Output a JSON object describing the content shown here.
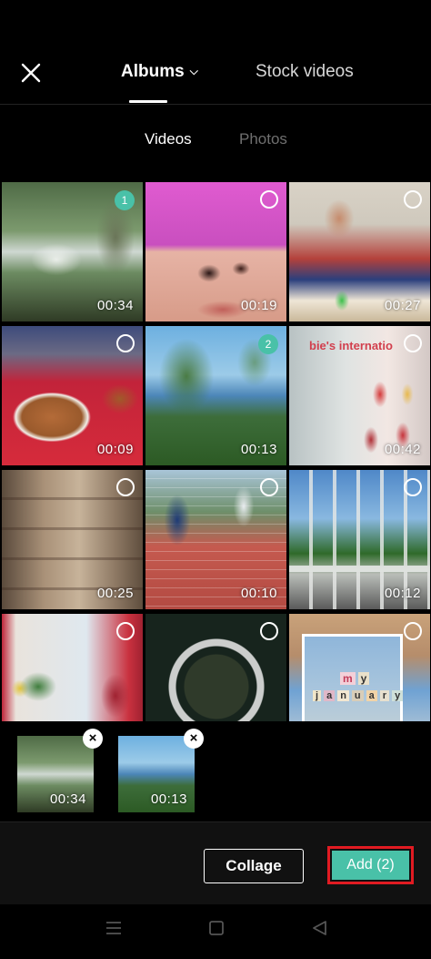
{
  "header": {
    "tabs": [
      {
        "label": "Albums",
        "active": true
      },
      {
        "label": "Stock videos",
        "active": false
      }
    ],
    "icons": {
      "close": "close-icon",
      "albums_dropdown": "chevron-down-icon"
    }
  },
  "media_tabs": [
    {
      "label": "Videos",
      "active": true
    },
    {
      "label": "Photos",
      "active": false
    }
  ],
  "grid": {
    "items": [
      {
        "duration": "00:34",
        "selected_order": "1"
      },
      {
        "duration": "00:19",
        "selected_order": ""
      },
      {
        "duration": "00:27",
        "selected_order": ""
      },
      {
        "duration": "00:09",
        "selected_order": ""
      },
      {
        "duration": "00:13",
        "selected_order": "2"
      },
      {
        "duration": "00:42",
        "selected_order": ""
      },
      {
        "duration": "00:25",
        "selected_order": ""
      },
      {
        "duration": "00:10",
        "selected_order": ""
      },
      {
        "duration": "00:12",
        "selected_order": ""
      },
      {
        "duration": "",
        "selected_order": ""
      },
      {
        "duration": "",
        "selected_order": ""
      },
      {
        "duration": "",
        "selected_order": ""
      }
    ],
    "overlay_texts": {
      "doll_sign": "bie's internatio",
      "cards": [
        "m",
        "y",
        "j",
        "a",
        "n",
        "u",
        "a",
        "r",
        "y"
      ]
    }
  },
  "selected_tray": [
    {
      "duration": "00:34"
    },
    {
      "duration": "00:13"
    }
  ],
  "actions": {
    "collage_label": "Collage",
    "add_label": "Add (2)"
  },
  "colors": {
    "accent": "#49c1a8",
    "highlight_outline": "#e11b22",
    "background": "#000000"
  },
  "system_nav": [
    "menu-icon",
    "home-icon",
    "back-icon"
  ]
}
